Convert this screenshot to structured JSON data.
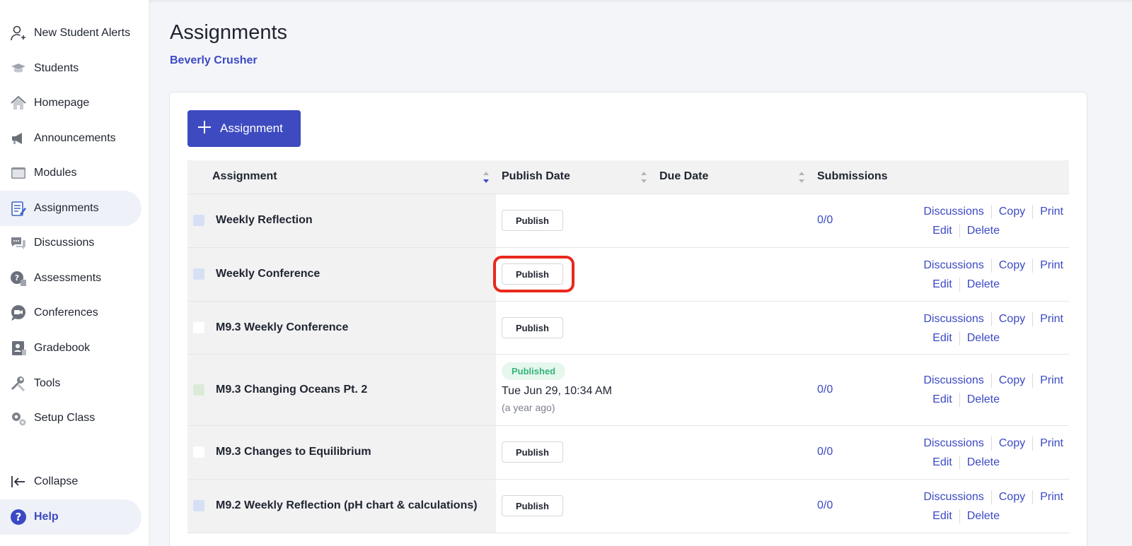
{
  "sidebar": {
    "items": [
      {
        "label": "New Student Alerts",
        "icon": "user-add-icon"
      },
      {
        "label": "Students",
        "icon": "graduation-cap-icon"
      },
      {
        "label": "Homepage",
        "icon": "home-icon"
      },
      {
        "label": "Announcements",
        "icon": "megaphone-icon"
      },
      {
        "label": "Modules",
        "icon": "folder-icon"
      },
      {
        "label": "Assignments",
        "icon": "assignment-icon"
      },
      {
        "label": "Discussions",
        "icon": "chat-bubbles-icon"
      },
      {
        "label": "Assessments",
        "icon": "assessment-icon"
      },
      {
        "label": "Conferences",
        "icon": "video-chat-icon"
      },
      {
        "label": "Gradebook",
        "icon": "gradebook-icon"
      },
      {
        "label": "Tools",
        "icon": "tools-icon"
      },
      {
        "label": "Setup Class",
        "icon": "gears-icon"
      }
    ],
    "collapse_label": "Collapse",
    "help_label": "Help",
    "help_icon_glyph": "?",
    "active_item": "Assignments"
  },
  "header": {
    "title": "Assignments",
    "teacher": "Beverly Crusher"
  },
  "toolbar": {
    "add_label": "Assignment"
  },
  "table": {
    "columns": [
      "Assignment",
      "Publish Date",
      "Due Date",
      "Submissions"
    ],
    "publish_label": "Publish",
    "published_badge": "Published",
    "action_labels": {
      "discussions": "Discussions",
      "copy": "Copy",
      "print": "Print",
      "edit": "Edit",
      "delete": "Delete"
    },
    "rows": [
      {
        "name": "Weekly Reflection",
        "submissions": "0/0",
        "status": "unpublished",
        "swatch": "#d6e0f5"
      },
      {
        "name": "Weekly Conference",
        "submissions": "",
        "status": "unpublished",
        "swatch": "#d6e0f5"
      },
      {
        "name": "M9.3 Weekly Conference",
        "submissions": "",
        "status": "unpublished",
        "swatch": "#ffffff"
      },
      {
        "name": "M9.3 Changing Oceans Pt. 2",
        "submissions": "0/0",
        "status": "published",
        "published_date": "Tue Jun 29, 10:34 AM",
        "published_relative": "(a year ago)",
        "swatch": "#dcebd9"
      },
      {
        "name": "M9.3 Changes to Equilibrium",
        "submissions": "0/0",
        "status": "unpublished",
        "swatch": "#ffffff"
      },
      {
        "name": "M9.2 Weekly Reflection (pH chart & calculations)",
        "submissions": "0/0",
        "status": "unpublished",
        "swatch": "#d6e0f5"
      }
    ]
  },
  "colors": {
    "accent": "#3d4ac0",
    "link": "#3b49c4",
    "highlight": "#e8291c",
    "published_green": "#35b47a"
  }
}
